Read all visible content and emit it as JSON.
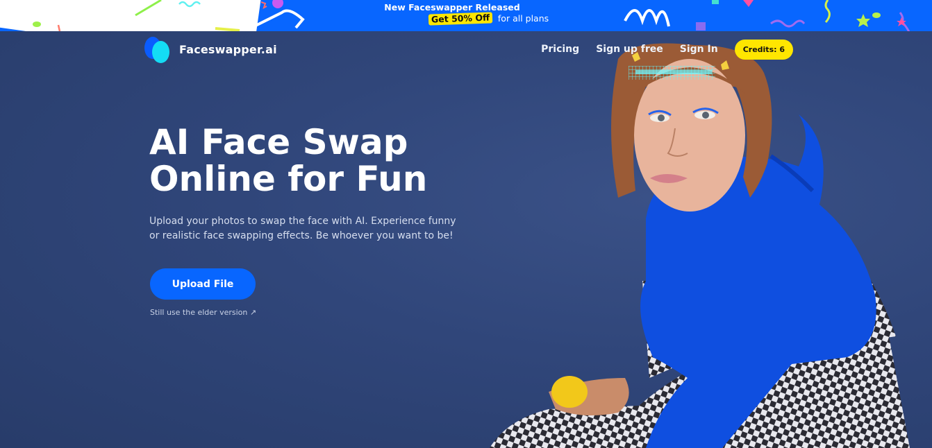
{
  "promo": {
    "line1": "New Faceswapper Released",
    "highlight": "Get 50% Off",
    "line2_rest": "for all plans",
    "colors": {
      "background": "#0866ff",
      "highlight": "#ffe600"
    }
  },
  "nav": {
    "brand": "Faceswapper.ai",
    "links": [
      {
        "label": "Pricing"
      },
      {
        "label": "Sign up free"
      },
      {
        "label": "Sign In"
      }
    ],
    "credits_label": "Credits: 6"
  },
  "hero": {
    "title_line1": "AI Face Swap",
    "title_line2": "Online for Fun",
    "subtitle": "Upload your photos to swap the face with AI. Experience funny or realistic face swapping effects. Be whoever you want to be!",
    "upload_button": "Upload File",
    "elder_link": "Still use the elder version",
    "elder_link_icon": "↗",
    "image_alt": "Woman with braided hair in blue hoodie and checkered overalls holding a lemon, with face-scan overlay"
  },
  "colors": {
    "accent": "#0866ff",
    "background": "#2e4373",
    "credits": "#ffe600"
  }
}
